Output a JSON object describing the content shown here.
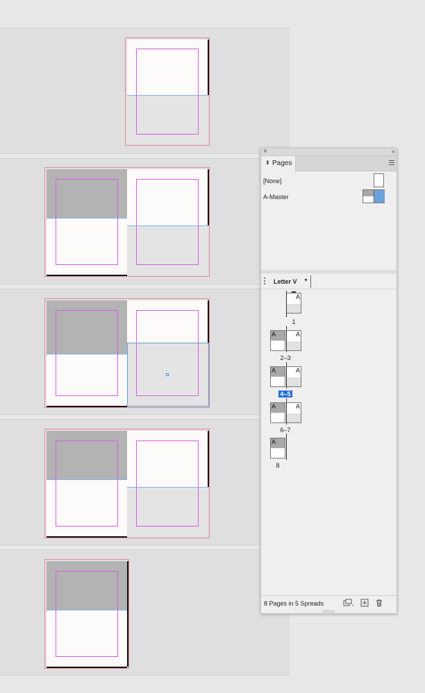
{
  "panel": {
    "tab_arrow": "⬍",
    "tab_label": "Pages",
    "close_glyph": "×",
    "collapse_glyph": "‹‹",
    "masters": [
      {
        "label": "[None]"
      },
      {
        "label": "A-Master"
      }
    ],
    "page_size": "Letter V",
    "spreads": [
      {
        "label": "1"
      },
      {
        "label": "2–3"
      },
      {
        "label": "4–5",
        "selected": true
      },
      {
        "label": "6–7"
      },
      {
        "label": "8"
      }
    ],
    "master_letter": "A",
    "footer_text": "8 Pages in 5 Spreads"
  },
  "colors": {
    "selection": "#1f6ed4",
    "margin_guide": "#d65ce0",
    "bleed_guide": "#e08a93",
    "ruler_guide": "#7fb6e8"
  },
  "icons": {
    "edit_page_size": "edit-page-size-icon",
    "new_page": "new-page-icon",
    "delete_page": "trash-icon"
  }
}
